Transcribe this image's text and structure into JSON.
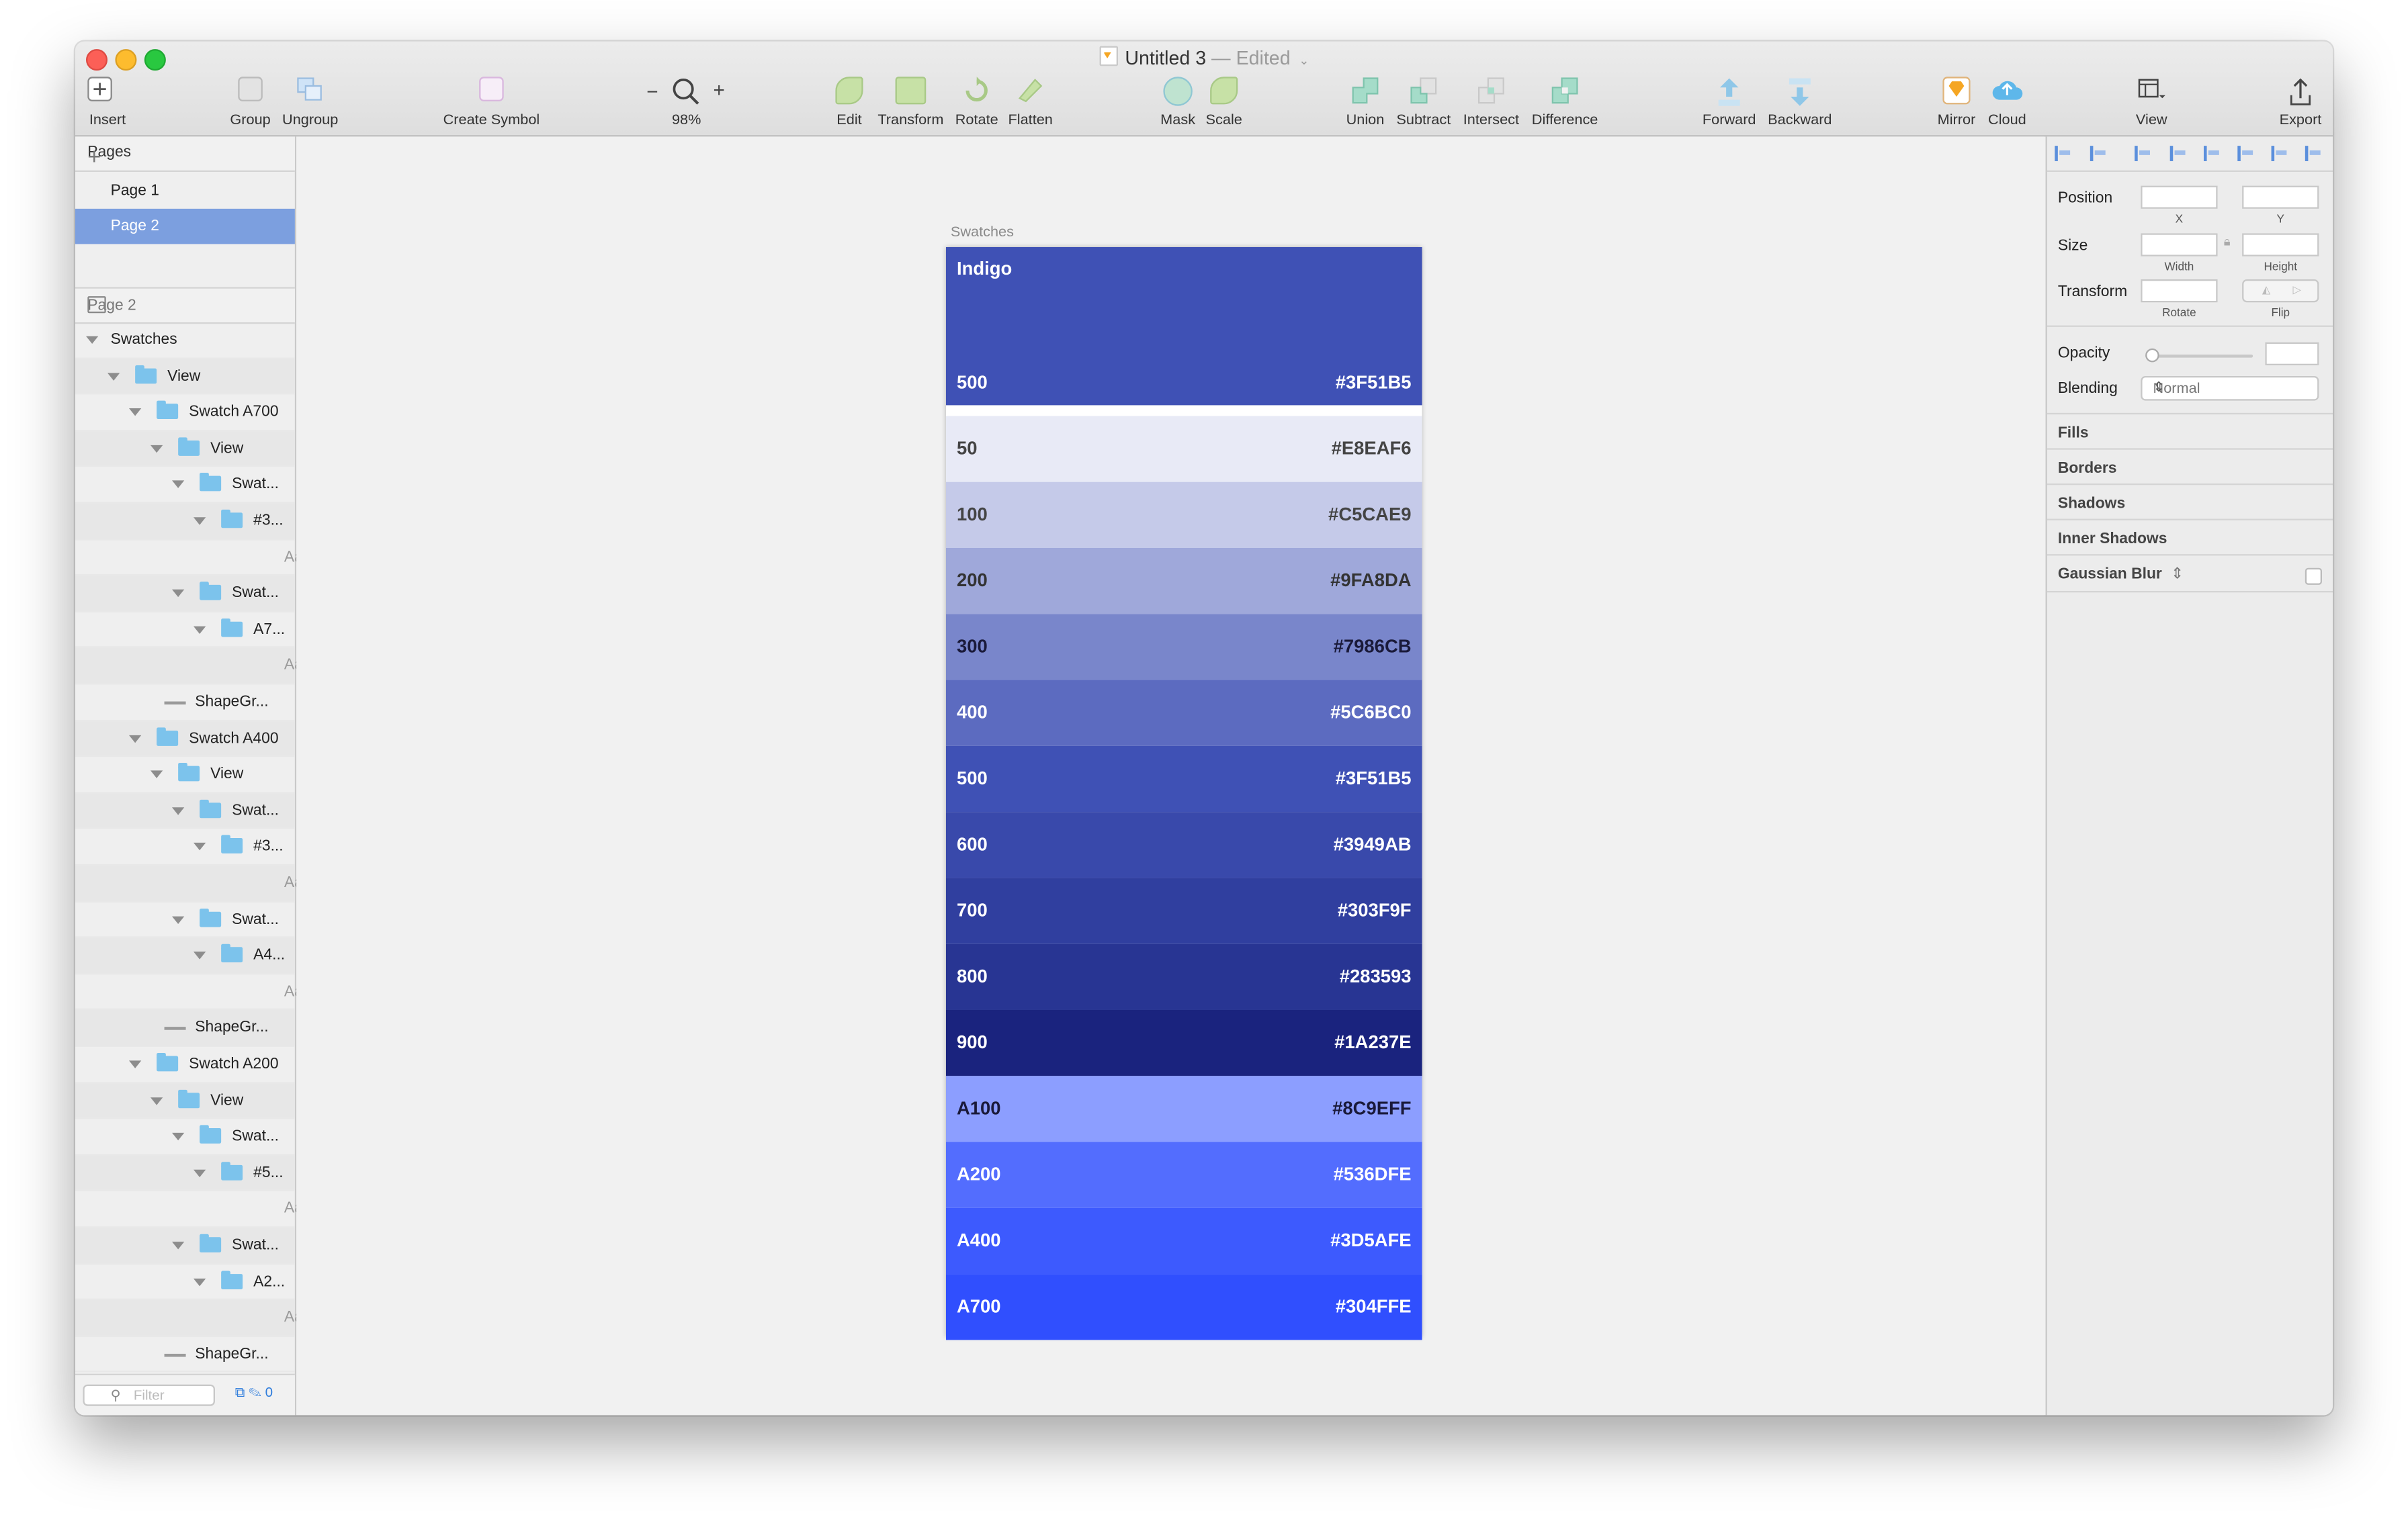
{
  "window": {
    "title": "Untitled 3",
    "edited": "— Edited",
    "title_caret": "⌄"
  },
  "toolbar": {
    "insert": "Insert",
    "group": "Group",
    "ungroup": "Ungroup",
    "create_symbol": "Create Symbol",
    "zoom_minus": "−",
    "zoom_plus": "+",
    "zoom": "98%",
    "edit": "Edit",
    "transform": "Transform",
    "rotate": "Rotate",
    "flatten": "Flatten",
    "mask": "Mask",
    "scale": "Scale",
    "union": "Union",
    "subtract": "Subtract",
    "intersect": "Intersect",
    "difference": "Difference",
    "forward": "Forward",
    "backward": "Backward",
    "mirror": "Mirror",
    "cloud": "Cloud",
    "view": "View",
    "export": "Export"
  },
  "pages": {
    "header": "Pages",
    "add": "+",
    "items": [
      "Page 1",
      "Page 2"
    ],
    "selected": "Page 2"
  },
  "layers": {
    "header": "Page 2",
    "items": [
      {
        "name": "Swatches",
        "type": "group"
      },
      {
        "name": "View",
        "type": "folder"
      },
      {
        "name": "Swatch A700",
        "type": "folder"
      },
      {
        "name": "View",
        "type": "folder"
      },
      {
        "name": "Swat...",
        "type": "folder"
      },
      {
        "name": "#3...",
        "type": "folder"
      },
      {
        "name": "#:",
        "type": "text"
      },
      {
        "name": "Swat...",
        "type": "folder"
      },
      {
        "name": "A7...",
        "type": "folder"
      },
      {
        "name": "A:",
        "type": "text"
      },
      {
        "name": "ShapeGr...",
        "type": "shape"
      },
      {
        "name": "Swatch A400",
        "type": "folder"
      },
      {
        "name": "View",
        "type": "folder"
      },
      {
        "name": "Swat...",
        "type": "folder"
      },
      {
        "name": "#3...",
        "type": "folder"
      },
      {
        "name": "#:",
        "type": "text"
      },
      {
        "name": "Swat...",
        "type": "folder"
      },
      {
        "name": "A4...",
        "type": "folder"
      },
      {
        "name": "A‹",
        "type": "text"
      },
      {
        "name": "ShapeGr...",
        "type": "shape"
      },
      {
        "name": "Swatch A200",
        "type": "folder"
      },
      {
        "name": "View",
        "type": "folder"
      },
      {
        "name": "Swat...",
        "type": "folder"
      },
      {
        "name": "#5...",
        "type": "folder"
      },
      {
        "name": "#!",
        "type": "text"
      },
      {
        "name": "Swat...",
        "type": "folder"
      },
      {
        "name": "A2...",
        "type": "folder"
      },
      {
        "name": "A:",
        "type": "text"
      },
      {
        "name": "ShapeGr...",
        "type": "shape"
      }
    ],
    "text_glyph": "Aa",
    "filter_placeholder": "Filter",
    "filter_count": "0"
  },
  "canvas": {
    "artboard_name": "Swatches",
    "header": {
      "title": "Indigo",
      "name": "500",
      "hex": "#3F51B5",
      "color": "#3F51B5"
    },
    "swatches": [
      {
        "name": "50",
        "hex": "#E8EAF6",
        "color": "#E8EAF6",
        "text": "#444444"
      },
      {
        "name": "100",
        "hex": "#C5CAE9",
        "color": "#C5CAE9",
        "text": "#444444"
      },
      {
        "name": "200",
        "hex": "#9FA8DA",
        "color": "#9FA8DA",
        "text": "#333333"
      },
      {
        "name": "300",
        "hex": "#7986CB",
        "color": "#7986CB",
        "text": "#1a1a3a"
      },
      {
        "name": "400",
        "hex": "#5C6BC0",
        "color": "#5C6BC0",
        "text": "#ffffff"
      },
      {
        "name": "500",
        "hex": "#3F51B5",
        "color": "#3F51B5",
        "text": "#ffffff"
      },
      {
        "name": "600",
        "hex": "#3949AB",
        "color": "#3949AB",
        "text": "#ffffff"
      },
      {
        "name": "700",
        "hex": "#303F9F",
        "color": "#303F9F",
        "text": "#ffffff"
      },
      {
        "name": "800",
        "hex": "#283593",
        "color": "#283593",
        "text": "#ffffff"
      },
      {
        "name": "900",
        "hex": "#1A237E",
        "color": "#1A237E",
        "text": "#ffffff"
      },
      {
        "name": "A100",
        "hex": "#8C9EFF",
        "color": "#8C9EFF",
        "text": "#1a1a3a"
      },
      {
        "name": "A200",
        "hex": "#536DFE",
        "color": "#536DFE",
        "text": "#ffffff"
      },
      {
        "name": "A400",
        "hex": "#3D5AFE",
        "color": "#3D5AFE",
        "text": "#ffffff"
      },
      {
        "name": "A700",
        "hex": "#304FFE",
        "color": "#304FFE",
        "text": "#ffffff"
      }
    ]
  },
  "inspector": {
    "position": "Position",
    "x": "X",
    "y": "Y",
    "size": "Size",
    "width": "Width",
    "height": "Height",
    "transform": "Transform",
    "rotate": "Rotate",
    "flip": "Flip",
    "opacity": "Opacity",
    "blending": "Blending",
    "blending_value": "Normal",
    "fills": "Fills",
    "borders": "Borders",
    "shadows": "Shadows",
    "inner_shadows": "Inner Shadows",
    "gaussian_blur": "Gaussian Blur"
  }
}
